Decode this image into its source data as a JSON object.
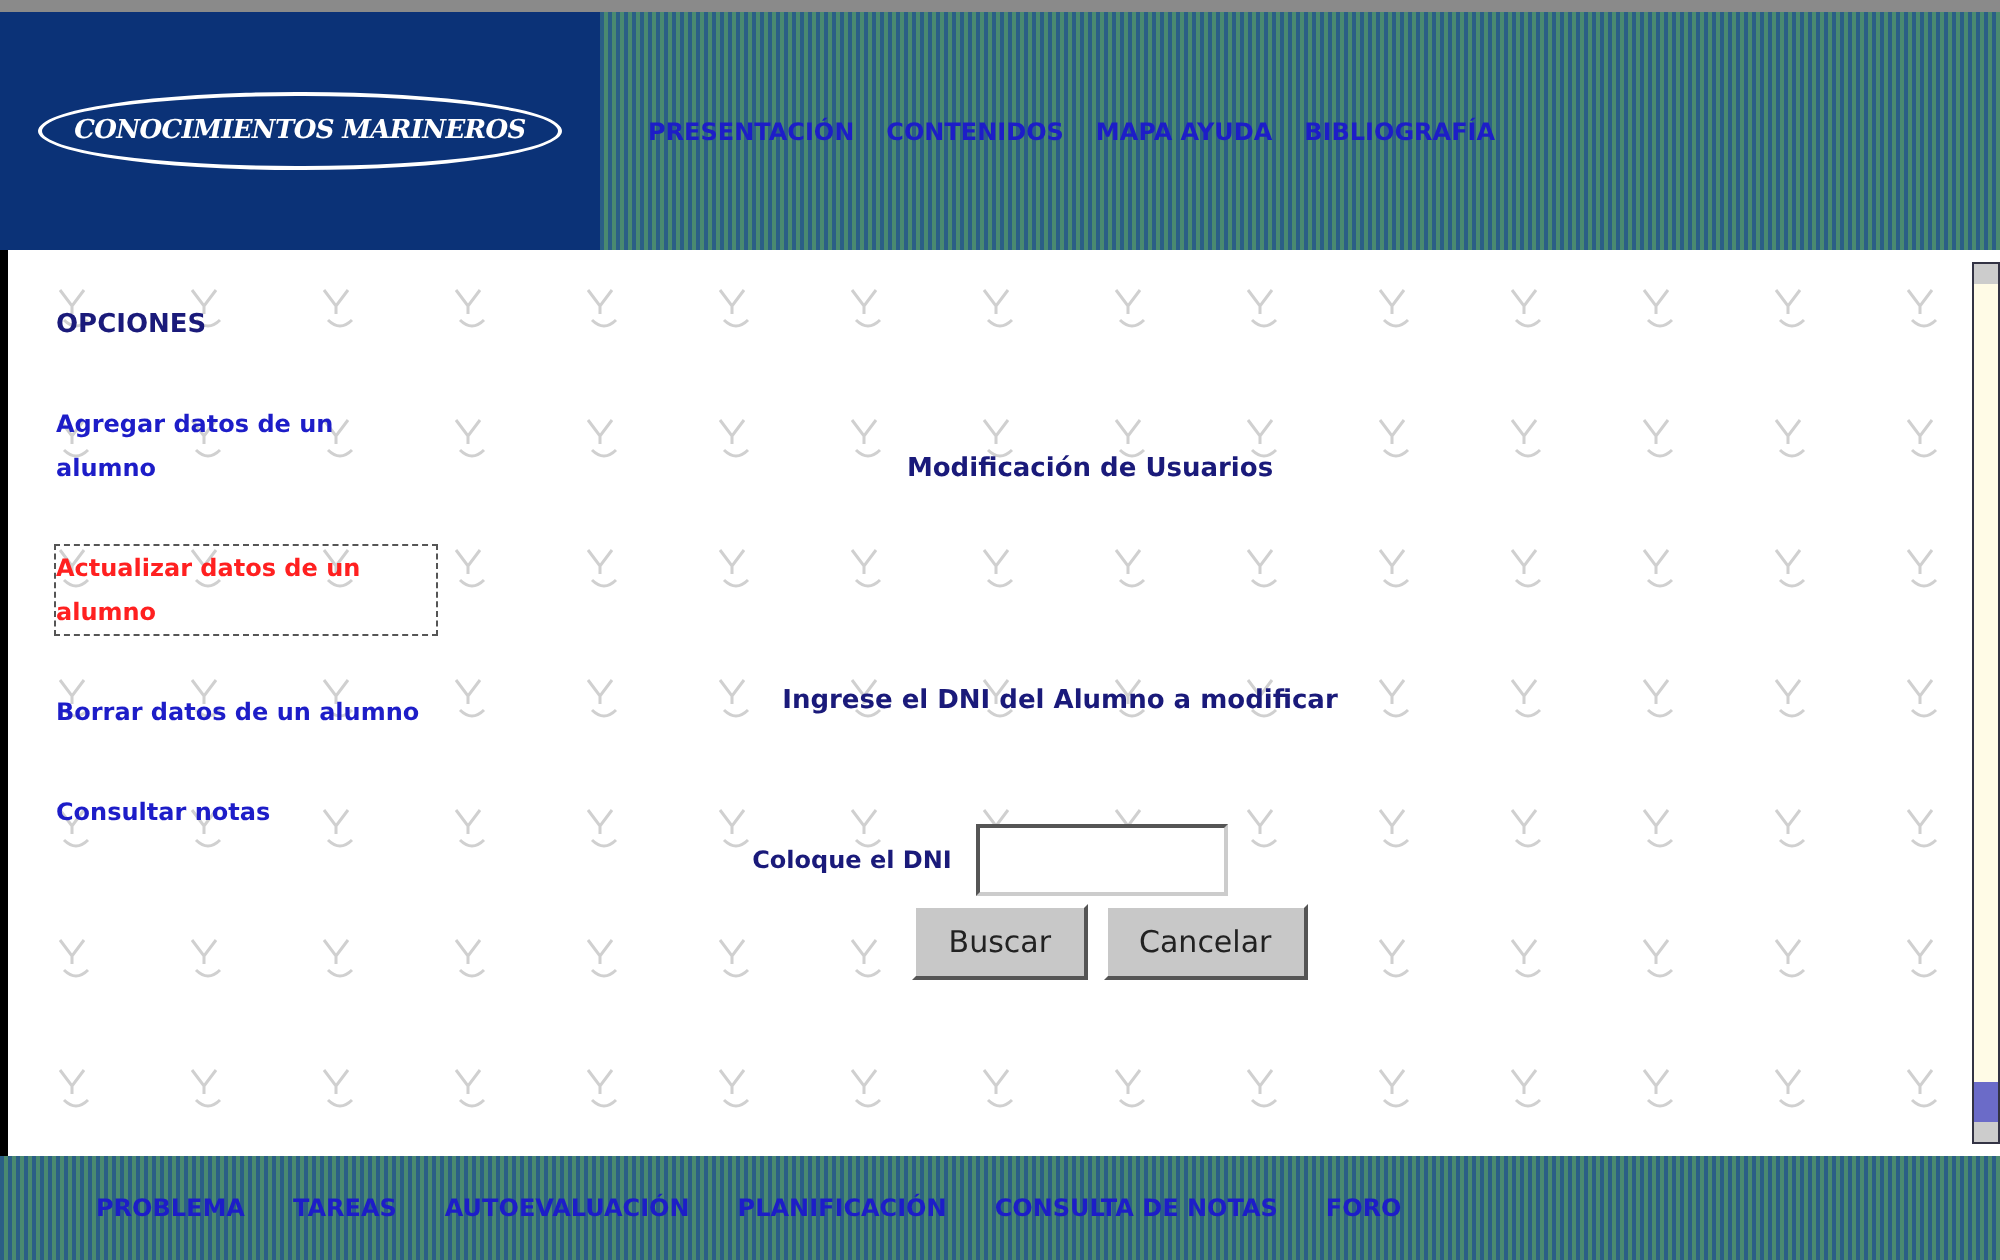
{
  "header": {
    "logo": "CONOCIMIENTOS MARINEROS",
    "nav": [
      "PRESENTACIÓN",
      "CONTENIDOS",
      "MAPA AYUDA",
      "BIBLIOGRAFÍA"
    ]
  },
  "sidebar": {
    "title": "OPCIONES",
    "items": [
      {
        "label": "Agregar datos de un alumno",
        "selected": false
      },
      {
        "label": "Actualizar datos de un alumno",
        "selected": true
      },
      {
        "label": "Borrar datos de un alumno",
        "selected": false
      },
      {
        "label": "Consultar notas",
        "selected": false
      }
    ]
  },
  "main": {
    "title": "Modificación de Usuarios",
    "instruction": "Ingrese el DNI del Alumno a  modificar",
    "field_label": "Coloque el DNI",
    "buttons": [
      "Buscar",
      "Cancelar"
    ]
  },
  "footer": {
    "nav": [
      "PROBLEMA",
      "TAREAS",
      "AUTOEVALUACIÓN",
      "PLANIFICACIÓN",
      "CONSULTA DE NOTAS",
      "FORO"
    ]
  }
}
